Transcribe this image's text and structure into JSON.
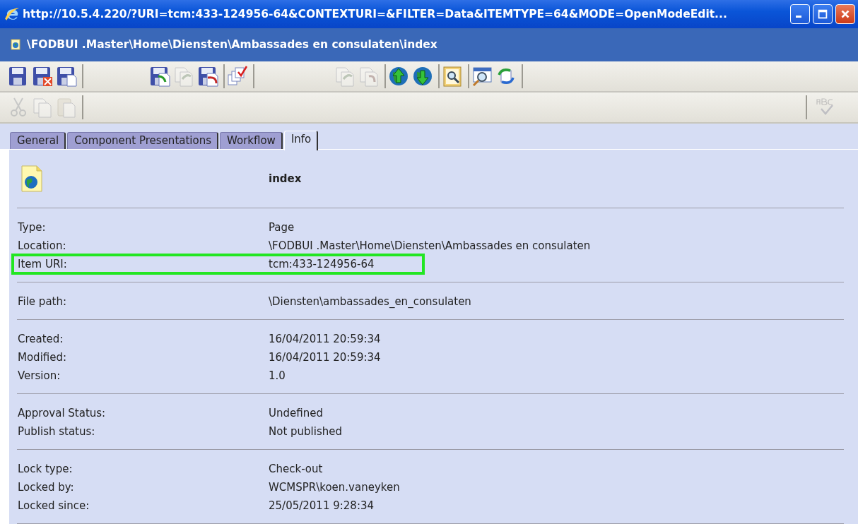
{
  "window": {
    "title": "http://10.5.4.220/?URI=tcm:433-124956-64&CONTEXTURI=&FILTER=Data&ITEMTYPE=64&MODE=OpenModeEdit..."
  },
  "path_bar": {
    "title": "\\FODBUI .Master\\Home\\Diensten\\Ambassades en consulaten\\index"
  },
  "toolbar": [
    [
      {
        "kind": "save",
        "disabled": false
      },
      {
        "kind": "save-close",
        "disabled": false
      },
      {
        "kind": "save-new",
        "disabled": false
      }
    ],
    [
      {
        "kind": "save-arrow",
        "disabled": false
      },
      {
        "kind": "copy-arrow",
        "disabled": true
      },
      {
        "kind": "save-undo",
        "disabled": false
      }
    ],
    [
      {
        "kind": "checklist",
        "disabled": false
      }
    ],
    [
      {
        "kind": "copy-arrow",
        "disabled": true
      },
      {
        "kind": "copy-undo",
        "disabled": true
      }
    ],
    [
      {
        "kind": "globe-up",
        "disabled": false
      },
      {
        "kind": "globe-down",
        "disabled": false
      }
    ],
    [
      {
        "kind": "preview",
        "disabled": false
      }
    ],
    [
      {
        "kind": "search-window",
        "disabled": false
      },
      {
        "kind": "refresh",
        "disabled": false
      }
    ]
  ],
  "edit_toolbar": [
    {
      "kind": "cut",
      "disabled": true
    },
    {
      "kind": "copy",
      "disabled": true
    },
    {
      "kind": "paste",
      "disabled": true
    }
  ],
  "spellcheck": {
    "disabled": true
  },
  "tabs": [
    {
      "label": "General",
      "selected": false
    },
    {
      "label": "Component Presentations",
      "selected": false
    },
    {
      "label": "Workflow",
      "selected": false
    },
    {
      "label": "Info",
      "selected": true
    }
  ],
  "item": {
    "name": "index"
  },
  "sections": [
    {
      "rows": [
        {
          "label": "Type:",
          "value": "Page",
          "highlighted": false
        },
        {
          "label": "Location:",
          "value": "\\FODBUI .Master\\Home\\Diensten\\Ambassades en consulaten",
          "highlighted": false
        },
        {
          "label": "Item URI:",
          "value": "tcm:433-124956-64",
          "highlighted": true
        }
      ]
    },
    {
      "rows": [
        {
          "label": "File path:",
          "value": "\\Diensten\\ambassades_en_consulaten",
          "highlighted": false
        }
      ]
    },
    {
      "rows": [
        {
          "label": "Created:",
          "value": "16/04/2011 20:59:34",
          "highlighted": false
        },
        {
          "label": "Modified:",
          "value": "16/04/2011 20:59:34",
          "highlighted": false
        },
        {
          "label": "Version:",
          "value": "1.0",
          "highlighted": false
        }
      ]
    },
    {
      "rows": [
        {
          "label": "Approval Status:",
          "value": "Undefined",
          "highlighted": false
        },
        {
          "label": "Publish status:",
          "value": "Not published",
          "highlighted": false
        }
      ]
    },
    {
      "rows": [
        {
          "label": "Lock type:",
          "value": "Check-out",
          "highlighted": false
        },
        {
          "label": "Locked by:",
          "value": "WCMSPR\\koen.vaneyken",
          "highlighted": false
        },
        {
          "label": "Locked since:",
          "value": "25/05/2011 9:28:34",
          "highlighted": false
        }
      ]
    }
  ]
}
